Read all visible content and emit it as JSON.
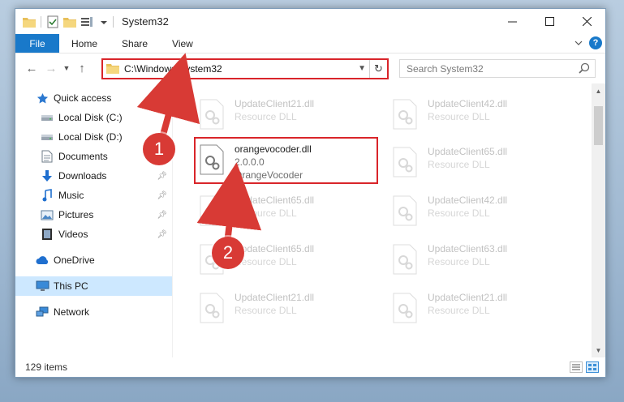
{
  "window": {
    "title": "System32"
  },
  "ribbon": {
    "tabs": [
      "File",
      "Home",
      "Share",
      "View"
    ]
  },
  "address": {
    "path": "C:\\Windows\\System32"
  },
  "search": {
    "placeholder": "Search System32"
  },
  "sidebar": {
    "items": [
      {
        "label": "Quick access",
        "icon": "star-icon"
      },
      {
        "label": "Local Disk (C:)",
        "icon": "drive-icon"
      },
      {
        "label": "Local Disk (D:)",
        "icon": "drive-icon"
      },
      {
        "label": "Documents",
        "icon": "documents-icon"
      },
      {
        "label": "Downloads",
        "icon": "download-icon",
        "pinned": true
      },
      {
        "label": "Music",
        "icon": "music-icon",
        "pinned": true
      },
      {
        "label": "Pictures",
        "icon": "pictures-icon",
        "pinned": true
      },
      {
        "label": "Videos",
        "icon": "videos-icon",
        "pinned": true
      },
      {
        "label": "OneDrive",
        "icon": "cloud-icon"
      },
      {
        "label": "This PC",
        "icon": "computer-icon",
        "selected": true
      },
      {
        "label": "Network",
        "icon": "network-icon"
      }
    ]
  },
  "files": {
    "highlighted": {
      "name": "orangevocoder.dll",
      "version": "2.0.0.0",
      "description": "OrangeVocoder"
    },
    "background": [
      {
        "name": "UpdateClient21.dll",
        "type": "Resource DLL"
      },
      {
        "name": "UpdateClient42.dll",
        "type": "Resource DLL"
      },
      {
        "name": "UpdateClient65.dll",
        "type": "Resource DLL"
      },
      {
        "name": "UpdateClient65.dll",
        "type": "Resource DLL"
      },
      {
        "name": "UpdateClient42.dll",
        "type": "Resource DLL"
      },
      {
        "name": "UpdateClient65.dll",
        "type": "Resource DLL"
      },
      {
        "name": "UpdateClient63.dll",
        "type": "Resource DLL"
      },
      {
        "name": "UpdateClient21.dll",
        "type": "Resource DLL"
      },
      {
        "name": "UpdateClient21.dll",
        "type": "Resource DLL"
      }
    ]
  },
  "status": {
    "item_count": "129 items"
  },
  "callouts": {
    "one": "1",
    "two": "2"
  },
  "colors": {
    "accent": "#1979ca",
    "highlight": "#d9252a",
    "callout": "#d83a35",
    "selected": "#cde8ff"
  }
}
